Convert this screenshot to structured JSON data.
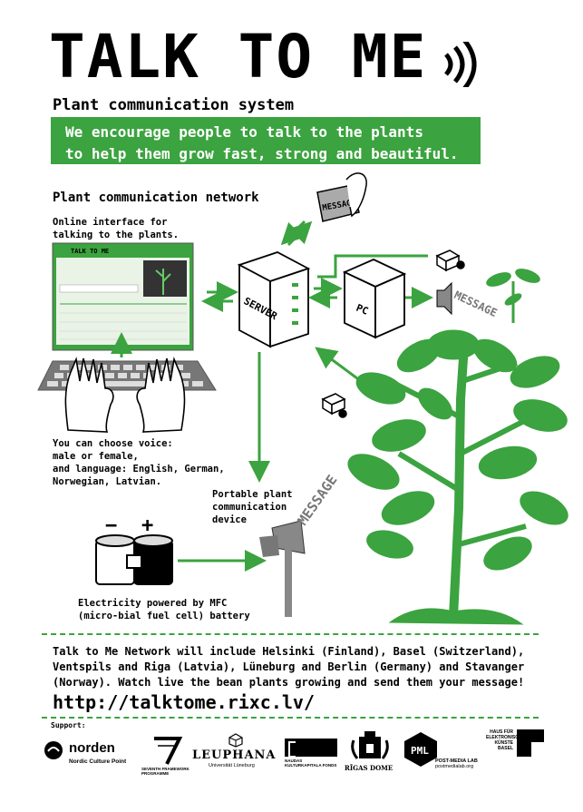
{
  "header": {
    "title": "TALK TO ME",
    "subtitle": "Plant communication system",
    "banner_line1": "We encourage people to talk to the plants",
    "banner_line2": "to help them grow fast, strong and beautiful."
  },
  "diagram": {
    "section_title": "Plant communication network",
    "online_interface_line1": "Online interface for",
    "online_interface_line2": "talking to the plants.",
    "voice_line1": "You can choose voice:",
    "voice_line2": "male or female,",
    "voice_line3": "and language: English, German,",
    "voice_line4": "Norwegian, Latvian.",
    "portable_line1": "Portable plant",
    "portable_line2": "communication",
    "portable_line3": "device",
    "electricity_line1": "Electricity powered by MFC",
    "electricity_line2": "(micro-bial fuel cell) battery",
    "server_label": "SERVER",
    "pc_label": "PC",
    "message_label": "MESSAGE",
    "minus": "−",
    "plus": "+",
    "screen_title": "TALK TO ME"
  },
  "footer": {
    "network_line1": "Talk to Me Network will include Helsinki (Finland), Basel (Switzerland),",
    "network_line2": "Ventspils and Riga (Latvia), Lüneburg and Berlin (Germany) and Stavanger",
    "network_line3": "(Norway). Watch live the bean plants growing and send them your message!",
    "url": "http://talktome.rixc.lv/",
    "support_label": "Support:",
    "logos": {
      "norden": "norden",
      "norden_sub": "Nordic Culture Point",
      "fp7_line1": "SEVENTH FRAMEWORK",
      "fp7_line2": "PROGRAMME",
      "leuphana": "LEUPHANA",
      "leuphana_sub": "Universität Lüneburg",
      "ventspils_line1": "NAUDAS",
      "ventspils_line2": "KULTURKAPITALA FONDS",
      "rigas_dome": "RĪGAS DOME",
      "pml_sub1": "POST-MEDIA LAB",
      "pml_sub2": "postmedialab.org",
      "haus_line1": "HAUS FÜR",
      "haus_line2": "ELEKTRONISCHE",
      "haus_line3": "KÜNSTE",
      "haus_line4": "BASEL"
    }
  },
  "colors": {
    "green": "#3ba33f",
    "black": "#000000",
    "gray": "#888888"
  }
}
